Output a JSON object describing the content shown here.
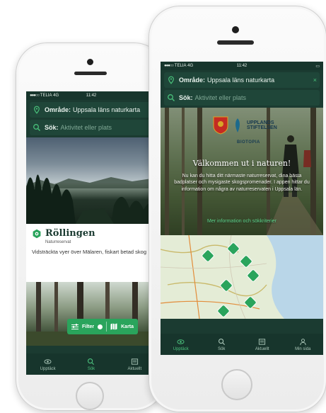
{
  "back_phone": {
    "status": {
      "carrier": "TELIA",
      "network": "4G",
      "time": "11:42"
    },
    "area_field": {
      "label": "Område:",
      "value": "Uppsala läns naturkarta"
    },
    "search_field": {
      "label": "Sök:",
      "placeholder": "Aktivitet eller plats"
    },
    "card": {
      "title": "Röllingen",
      "type": "Naturreservat",
      "description": "Vidsträckta vyer över Mälaren, fiskart betad skog"
    },
    "filter_bar": {
      "filter_label": "Filter",
      "map_label": "Karta"
    },
    "tabs": [
      {
        "label": "Upptäck",
        "icon": "eye-icon"
      },
      {
        "label": "Sök",
        "icon": "search-icon",
        "active": true
      },
      {
        "label": "Aktuellt",
        "icon": "news-icon"
      }
    ]
  },
  "front_phone": {
    "status": {
      "carrier": "TELIA",
      "network": "4G",
      "time": "11:42"
    },
    "area_field": {
      "label": "Område:",
      "value": "Uppsala läns naturkarta",
      "close": "×"
    },
    "search_field": {
      "label": "Sök:",
      "placeholder": "Aktivitet eller plats"
    },
    "logos": {
      "org": "UPPLANDS\nSTIFTELSEN",
      "brand": "BIOTOPIA"
    },
    "welcome_title": "Välkommen ut i naturen!",
    "intro_text": "Nu kan du hitta ditt närmaste naturreservat, dina bästa badplatser och mysigaste skogspromenader. I appen hittar du information om några av naturreservaten i Uppsala län.",
    "more_link": "Mer information och sökkriterier",
    "tabs": [
      {
        "label": "Upptäck",
        "icon": "eye-icon",
        "active": true
      },
      {
        "label": "Sök",
        "icon": "search-icon"
      },
      {
        "label": "Aktuellt",
        "icon": "news-icon"
      },
      {
        "label": "Min sida",
        "icon": "person-icon"
      }
    ]
  },
  "colors": {
    "header_bg": "#1b3b31",
    "accent_green": "#2aa45c",
    "active_tab": "#4cc27e",
    "card_title": "#1b3b31"
  }
}
